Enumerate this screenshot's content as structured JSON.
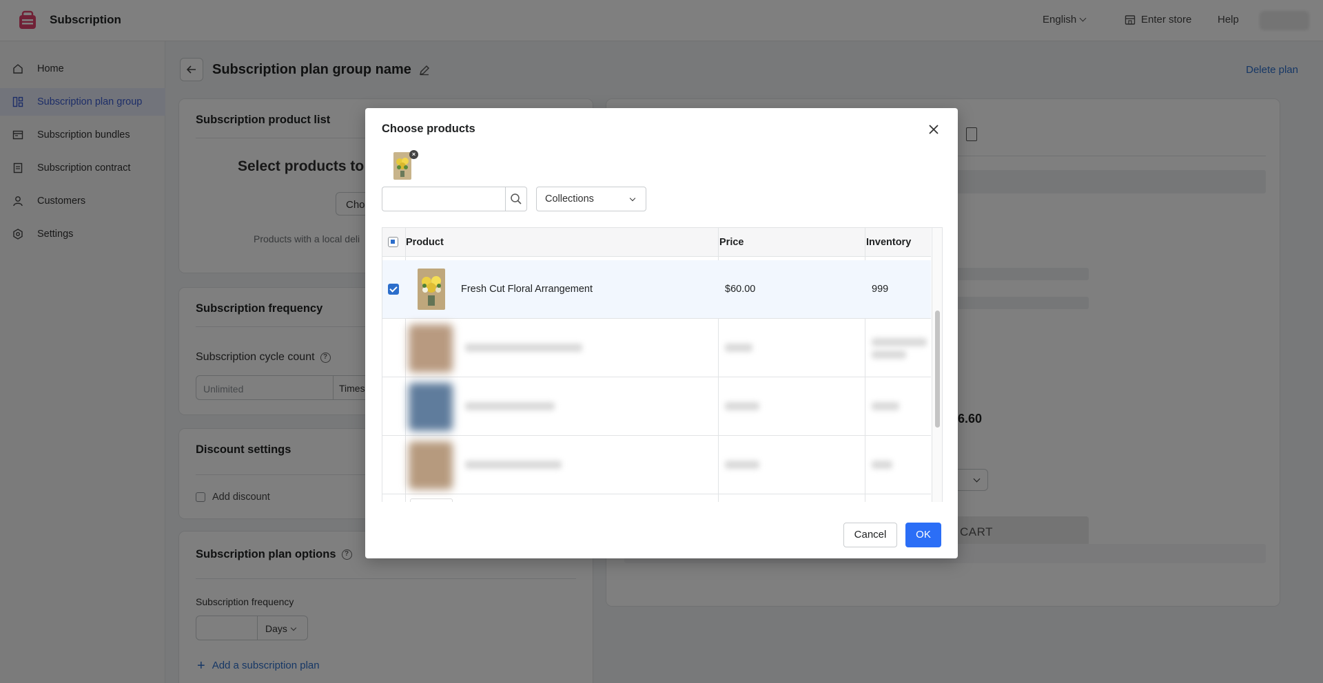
{
  "app": {
    "title": "Subscription"
  },
  "topbar": {
    "language": "English",
    "enter_store": "Enter store",
    "help": "Help"
  },
  "sidebar": {
    "items": [
      {
        "label": "Home",
        "icon": "home-icon",
        "active": false
      },
      {
        "label": "Subscription plan group",
        "icon": "layout-icon",
        "active": true
      },
      {
        "label": "Subscription bundles",
        "icon": "bundle-icon",
        "active": false
      },
      {
        "label": "Subscription contract",
        "icon": "contract-icon",
        "active": false
      },
      {
        "label": "Customers",
        "icon": "person-icon",
        "active": false
      },
      {
        "label": "Settings",
        "icon": "gear-icon",
        "active": false
      }
    ]
  },
  "page": {
    "title": "Subscription plan group name",
    "delete_label": "Delete plan"
  },
  "product_list_card": {
    "title": "Subscription product list",
    "heading": "Select products to a",
    "choose_button": "Choo",
    "note": "Products with a local deli"
  },
  "frequency_card": {
    "title": "Subscription frequency",
    "cycle_label": "Subscription cycle count",
    "cycle_placeholder": "Unlimited",
    "times_label": "Times"
  },
  "discount_card": {
    "title": "Discount settings",
    "add_discount": "Add discount"
  },
  "plan_options_card": {
    "title": "Subscription plan options",
    "frequency_label": "Subscription frequency",
    "unit": "Days",
    "add_plan": "Add a subscription plan"
  },
  "preview": {
    "price_fragment": "6.60",
    "cart_label": "CART"
  },
  "modal": {
    "title": "Choose products",
    "search_placeholder": "",
    "collections_label": "Collections",
    "columns": {
      "product": "Product",
      "price": "Price",
      "inventory": "Inventory"
    },
    "rows": [
      {
        "name": "Fresh Cut Floral Arrangement",
        "price": "$60.00",
        "inventory": "999",
        "checked": true
      }
    ],
    "cancel": "Cancel",
    "ok": "OK"
  },
  "colors": {
    "accent": "#2b6ef6",
    "link": "#2c6ecb",
    "active_nav_bg": "#e4e9f6",
    "logo": "#e0436c"
  }
}
